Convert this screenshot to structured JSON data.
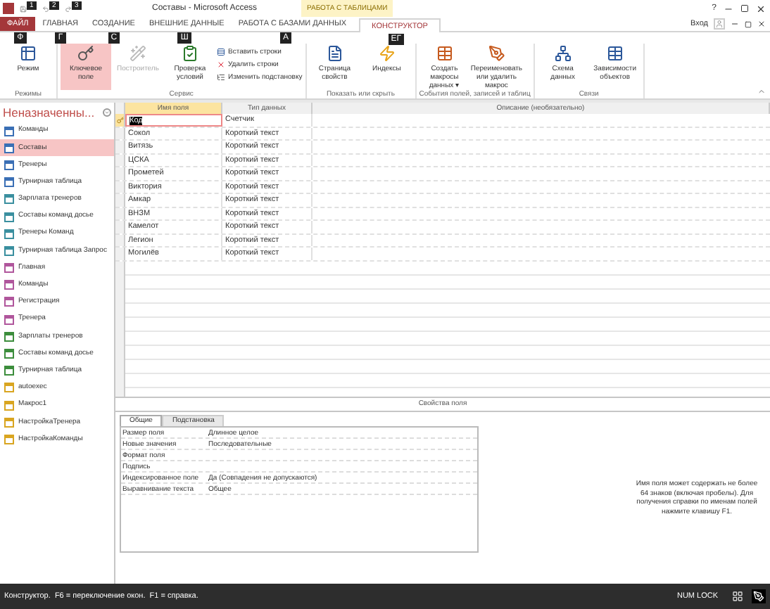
{
  "window": {
    "title": "Составы - Microsoft Access",
    "context_group": "РАБОТА С ТАБЛИЦАМИ",
    "help": "?",
    "sign_in": "Вход"
  },
  "quick_access_keytips": [
    "1",
    "2",
    "3"
  ],
  "tabs": [
    {
      "label": "ФАЙЛ",
      "kind": "file",
      "keytip": "Ф",
      "selected": false
    },
    {
      "label": "ГЛАВНАЯ",
      "kind": "tab",
      "keytip": "Г",
      "selected": false
    },
    {
      "label": "СОЗДАНИЕ",
      "kind": "tab",
      "keytip": "С",
      "selected": false
    },
    {
      "label": "ВНЕШНИЕ ДАННЫЕ",
      "kind": "tab",
      "keytip": "Ш",
      "selected": false
    },
    {
      "label": "РАБОТА С БАЗАМИ ДАННЫХ",
      "kind": "tab",
      "keytip": "А",
      "selected": false
    },
    {
      "label": "КОНСТРУКТОР",
      "kind": "context",
      "keytip": "ЕГ",
      "selected": true
    }
  ],
  "ribbon": [
    {
      "label": "Режимы",
      "buttons": [
        {
          "label": "Режим",
          "kind": "large",
          "active": false,
          "disabled": false
        }
      ]
    },
    {
      "label": "Сервис",
      "buttons": [
        {
          "label": "Ключевое поле",
          "kind": "large",
          "active": true,
          "disabled": false
        },
        {
          "label": "Построитель",
          "kind": "large",
          "active": false,
          "disabled": true
        },
        {
          "label": "Проверка условий",
          "kind": "large",
          "active": false,
          "disabled": false
        },
        {
          "label": "Вставить строки",
          "kind": "small",
          "active": false,
          "disabled": false
        },
        {
          "label": "Удалить строки",
          "kind": "small",
          "active": false,
          "disabled": false
        },
        {
          "label": "Изменить подстановку",
          "kind": "small",
          "active": false,
          "disabled": false
        }
      ]
    },
    {
      "label": "Показать или скрыть",
      "buttons": [
        {
          "label": "Страница свойств",
          "kind": "large",
          "active": false,
          "disabled": false
        },
        {
          "label": "Индексы",
          "kind": "large",
          "active": false,
          "disabled": false
        }
      ]
    },
    {
      "label": "События полей, записей и таблиц",
      "buttons": [
        {
          "label": "Создать макросы данных ▾",
          "kind": "large",
          "active": false,
          "disabled": false
        },
        {
          "label": "Переименовать или удалить макрос",
          "kind": "large",
          "active": false,
          "disabled": false
        }
      ]
    },
    {
      "label": "Связи",
      "buttons": [
        {
          "label": "Схема данных",
          "kind": "large",
          "active": false,
          "disabled": false
        },
        {
          "label": "Зависимости объектов",
          "kind": "large",
          "active": false,
          "disabled": false
        }
      ]
    }
  ],
  "navigation": {
    "title": "Неназначенны...",
    "items": [
      {
        "label": "Команды",
        "kind": "table",
        "selected": false
      },
      {
        "label": "Составы",
        "kind": "table",
        "selected": true
      },
      {
        "label": "Тренеры",
        "kind": "table",
        "selected": false
      },
      {
        "label": "Турнирная таблица",
        "kind": "table",
        "selected": false
      },
      {
        "label": "Зарплата тренеров",
        "kind": "query",
        "selected": false
      },
      {
        "label": "Составы команд досье",
        "kind": "query",
        "selected": false
      },
      {
        "label": "Тренеры Команд",
        "kind": "query",
        "selected": false
      },
      {
        "label": "Турнирная таблица Запрос",
        "kind": "query",
        "selected": false
      },
      {
        "label": "Главная",
        "kind": "form",
        "selected": false
      },
      {
        "label": "Команды",
        "kind": "form",
        "selected": false
      },
      {
        "label": "Регистрация",
        "kind": "form",
        "selected": false
      },
      {
        "label": "Тренера",
        "kind": "form",
        "selected": false
      },
      {
        "label": "Зарплаты тренеров",
        "kind": "report",
        "selected": false
      },
      {
        "label": "Составы команд досье",
        "kind": "report",
        "selected": false
      },
      {
        "label": "Турнирная таблица",
        "kind": "report",
        "selected": false
      },
      {
        "label": "autoexec",
        "kind": "macro",
        "selected": false
      },
      {
        "label": "Макрос1",
        "kind": "macro",
        "selected": false
      },
      {
        "label": "НастройкаТренера",
        "kind": "macro",
        "selected": false
      },
      {
        "label": "НастройкаКоманды",
        "kind": "macro",
        "selected": false
      }
    ]
  },
  "design_grid": {
    "columns": [
      "Имя поля",
      "Тип данных",
      "Описание (необязательно)"
    ],
    "rows": [
      {
        "name": "Код",
        "type": "Счетчик",
        "selected": true,
        "primary_key": true
      },
      {
        "name": "Сокол",
        "type": "Короткий текст",
        "selected": false,
        "primary_key": false
      },
      {
        "name": "Витязь",
        "type": "Короткий текст",
        "selected": false,
        "primary_key": false
      },
      {
        "name": "ЦСКА",
        "type": "Короткий текст",
        "selected": false,
        "primary_key": false
      },
      {
        "name": "Прометей",
        "type": "Короткий текст",
        "selected": false,
        "primary_key": false
      },
      {
        "name": "Виктория",
        "type": "Короткий текст",
        "selected": false,
        "primary_key": false
      },
      {
        "name": "Амкар",
        "type": "Короткий текст",
        "selected": false,
        "primary_key": false
      },
      {
        "name": "ВНЗМ",
        "type": "Короткий текст",
        "selected": false,
        "primary_key": false
      },
      {
        "name": "Камелот",
        "type": "Короткий текст",
        "selected": false,
        "primary_key": false
      },
      {
        "name": "Легион",
        "type": "Короткий текст",
        "selected": false,
        "primary_key": false
      },
      {
        "name": "Могилёв",
        "type": "Короткий текст",
        "selected": false,
        "primary_key": false
      }
    ]
  },
  "field_properties": {
    "title": "Свойства поля",
    "tabs": [
      {
        "label": "Общие",
        "selected": true
      },
      {
        "label": "Подстановка",
        "selected": false
      }
    ],
    "rows": [
      {
        "label": "Размер поля",
        "value": "Длинное целое"
      },
      {
        "label": "Новые значения",
        "value": "Последовательные"
      },
      {
        "label": "Формат поля"
      },
      {
        "label": "Подпись"
      },
      {
        "label": "Индексированное поле",
        "value": "Да (Совпадения не допускаются)"
      },
      {
        "label": "Выравнивание текста",
        "value": "Общее"
      }
    ],
    "help": "Имя поля может содержать не более 64 знаков (включая пробелы). Для получения справки по именам полей нажмите клавишу F1."
  },
  "status_bar": {
    "text": "Конструктор.  F6 = переключение окон.  F1 = справка.",
    "num_lock": "NUM LOCK"
  }
}
